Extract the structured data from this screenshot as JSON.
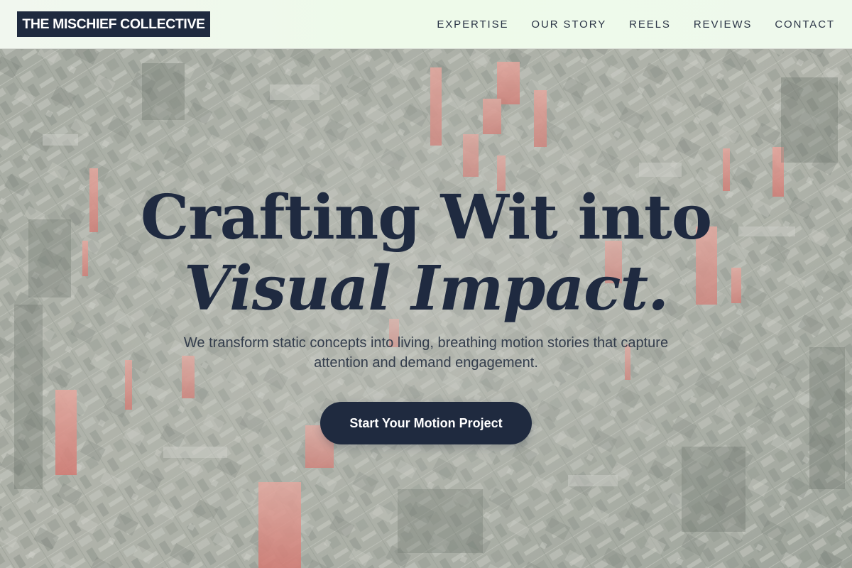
{
  "header": {
    "logo_text": "THE MISCHIEF COLLECTIVE",
    "nav": [
      {
        "label": "EXPERTISE"
      },
      {
        "label": "OUR STORY"
      },
      {
        "label": "REELS"
      },
      {
        "label": "REVIEWS"
      },
      {
        "label": "CONTACT"
      }
    ]
  },
  "hero": {
    "headline_line1": "Crafting Wit into",
    "headline_line2": "Visual Impact.",
    "subheadline": "We transform static concepts into living, breathing motion stories that capture attention and demand engagement.",
    "cta_label": "Start Your Motion Project"
  },
  "colors": {
    "brand_dark": "#1f2a3f",
    "header_bg": "#eef9ec",
    "accent_glow": "#f07a72"
  }
}
